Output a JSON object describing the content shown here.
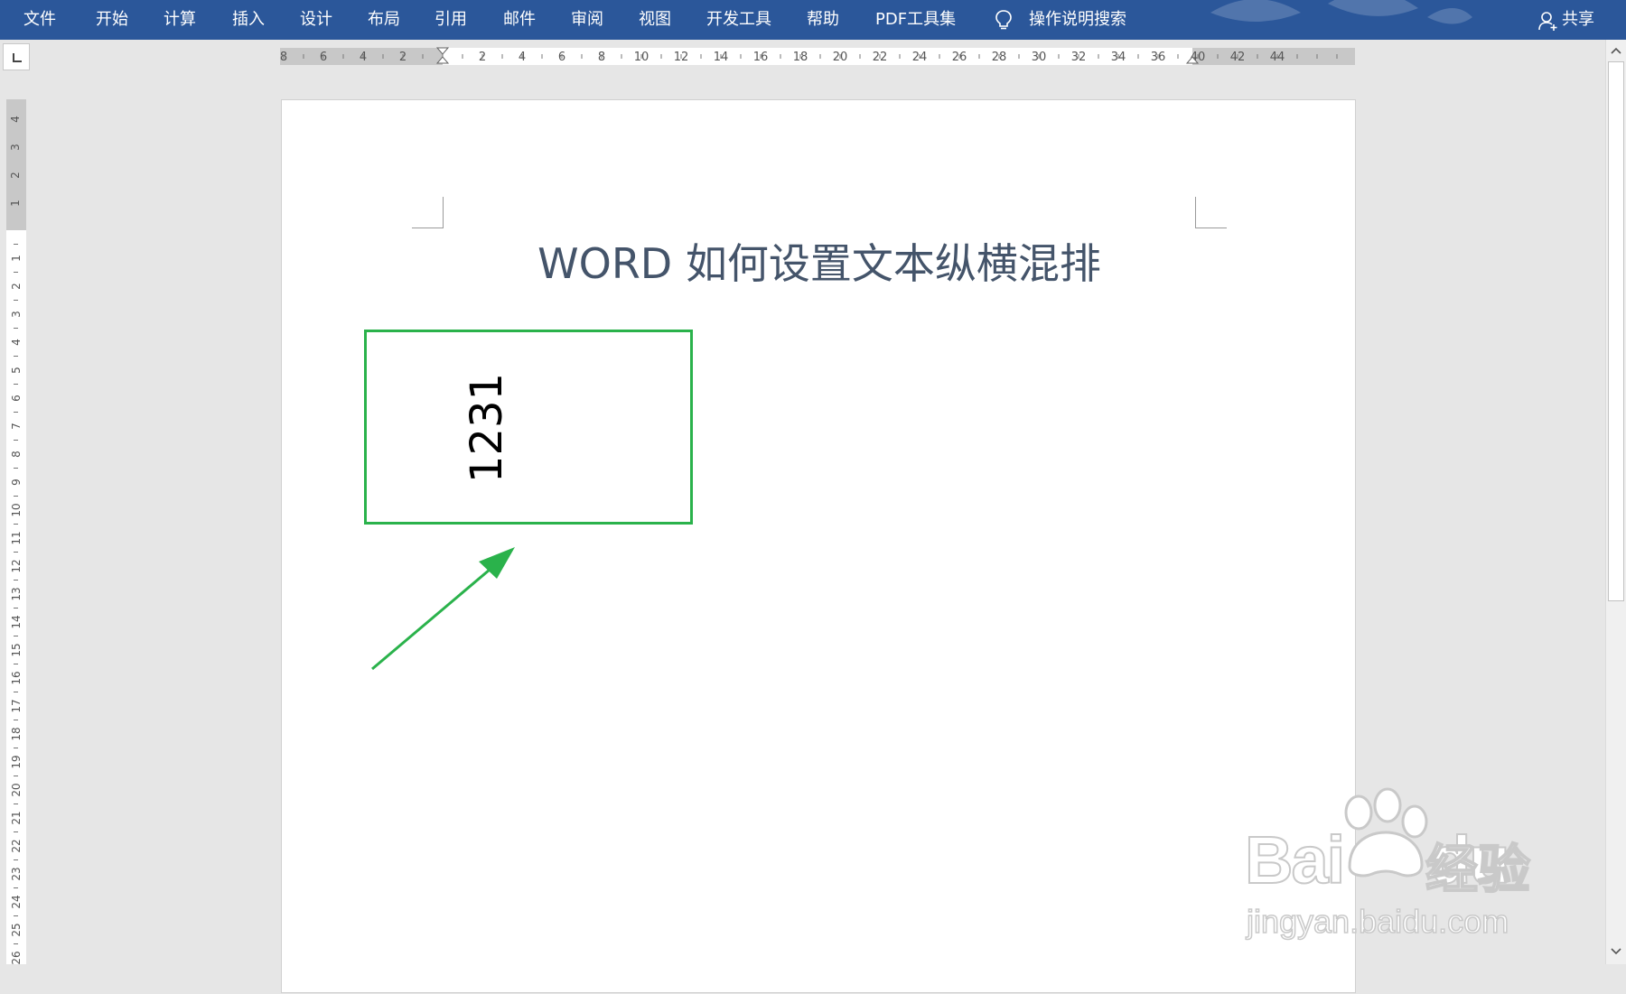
{
  "menubar": {
    "items": [
      {
        "name": "menu-file",
        "label": "文件"
      },
      {
        "name": "menu-home",
        "label": "开始"
      },
      {
        "name": "menu-calculate",
        "label": "计算"
      },
      {
        "name": "menu-insert",
        "label": "插入"
      },
      {
        "name": "menu-design",
        "label": "设计"
      },
      {
        "name": "menu-layout",
        "label": "布局"
      },
      {
        "name": "menu-references",
        "label": "引用"
      },
      {
        "name": "menu-mailings",
        "label": "邮件"
      },
      {
        "name": "menu-review",
        "label": "审阅"
      },
      {
        "name": "menu-view",
        "label": "视图"
      },
      {
        "name": "menu-developer",
        "label": "开发工具"
      },
      {
        "name": "menu-help",
        "label": "帮助"
      },
      {
        "name": "menu-pdf-tools",
        "label": "PDF工具集"
      }
    ],
    "tell_me": {
      "icon": "lightbulb-icon",
      "label": "操作说明搜索"
    },
    "share": {
      "icon": "person-icon",
      "label": "共享"
    },
    "accent_color": "#2b579a"
  },
  "hruler": {
    "left_labels": [
      "8",
      "6",
      "4",
      "2"
    ],
    "right_labels": [
      "2",
      "4",
      "6",
      "8",
      "10",
      "12",
      "14",
      "16",
      "18",
      "20",
      "22",
      "24",
      "26",
      "28",
      "30",
      "32",
      "34",
      "36",
      "40",
      "42",
      "44"
    ]
  },
  "vruler": {
    "top_labels": [
      "4",
      "3",
      "2",
      "1"
    ],
    "labels": [
      "1",
      "2",
      "3",
      "4",
      "5",
      "6",
      "7",
      "8",
      "9",
      "10",
      "11",
      "12",
      "13",
      "14",
      "15",
      "16",
      "17",
      "18",
      "19",
      "20",
      "21",
      "22",
      "23",
      "24",
      "25",
      "26"
    ]
  },
  "document": {
    "title": "WORD 如何设置文本纵横混排",
    "textbox_text": "1231",
    "textbox_border_color": "#2ab24b",
    "arrow_color": "#2ab24b",
    "title_color": "#44546a"
  },
  "watermark": {
    "brand": "Bai",
    "brand_tail": "du",
    "brand_cn": "经验",
    "url": "jingyan.baidu.com"
  }
}
